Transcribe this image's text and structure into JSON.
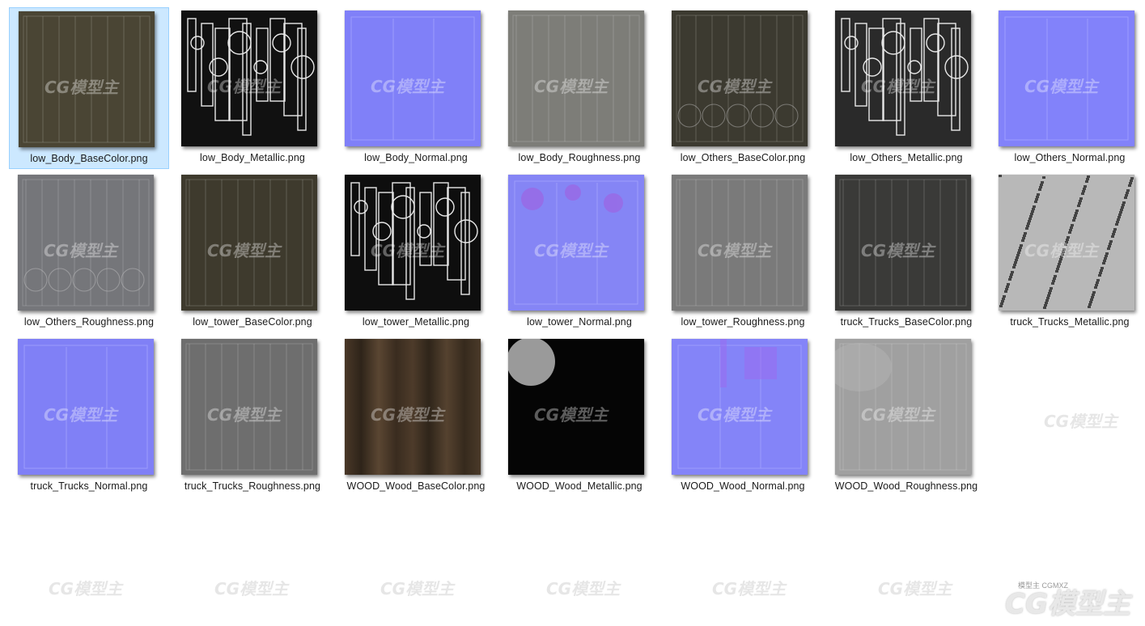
{
  "files": [
    {
      "name": "low_Body_BaseColor.png",
      "type": "basecolor",
      "color": "#4a4534",
      "selected": true
    },
    {
      "name": "low_Body_Metallic.png",
      "type": "metallic",
      "color": "#111111",
      "selected": false
    },
    {
      "name": "low_Body_Normal.png",
      "type": "normal",
      "color": "#8080f8",
      "selected": false
    },
    {
      "name": "low_Body_Roughness.png",
      "type": "roughness",
      "color": "#7d7d78",
      "selected": false
    },
    {
      "name": "low_Others_BaseColor.png",
      "type": "basecolor",
      "color": "#3c3a30",
      "selected": false
    },
    {
      "name": "low_Others_Metallic.png",
      "type": "metallic",
      "color": "#2a2a2a",
      "selected": false
    },
    {
      "name": "low_Others_Normal.png",
      "type": "normal",
      "color": "#8282fa",
      "selected": false
    },
    {
      "name": "low_Others_Roughness.png",
      "type": "roughness",
      "color": "#75767a",
      "selected": false
    },
    {
      "name": "low_tower_BaseColor.png",
      "type": "basecolor",
      "color": "#3e3a2d",
      "selected": false
    },
    {
      "name": "low_tower_Metallic.png",
      "type": "metallic",
      "color": "#0e0e0e",
      "selected": false
    },
    {
      "name": "low_tower_Normal.png",
      "type": "normal",
      "color": "#8585f5",
      "selected": false
    },
    {
      "name": "low_tower_Roughness.png",
      "type": "roughness",
      "color": "#7a7a7a",
      "selected": false
    },
    {
      "name": "truck_Trucks_BaseColor.png",
      "type": "basecolor",
      "color": "#3a3a38",
      "selected": false
    },
    {
      "name": "truck_Trucks_Metallic.png",
      "type": "noise",
      "color": "#b8b8b8",
      "selected": false
    },
    {
      "name": "truck_Trucks_Normal.png",
      "type": "normal",
      "color": "#8080f6",
      "selected": false
    },
    {
      "name": "truck_Trucks_Roughness.png",
      "type": "roughness",
      "color": "#6e6e6e",
      "selected": false
    },
    {
      "name": "WOOD_Wood_BaseColor.png",
      "type": "wood",
      "color": "#3d2f22",
      "selected": false
    },
    {
      "name": "WOOD_Wood_Metallic.png",
      "type": "black",
      "color": "#050505",
      "selected": false
    },
    {
      "name": "WOOD_Wood_Normal.png",
      "type": "normal",
      "color": "#8484f8",
      "selected": false
    },
    {
      "name": "WOOD_Wood_Roughness.png",
      "type": "roughness",
      "color": "#a0a0a0",
      "selected": false
    }
  ],
  "watermark": {
    "text": "CG模型主",
    "sub_text": "模型主 CGMXZ"
  }
}
